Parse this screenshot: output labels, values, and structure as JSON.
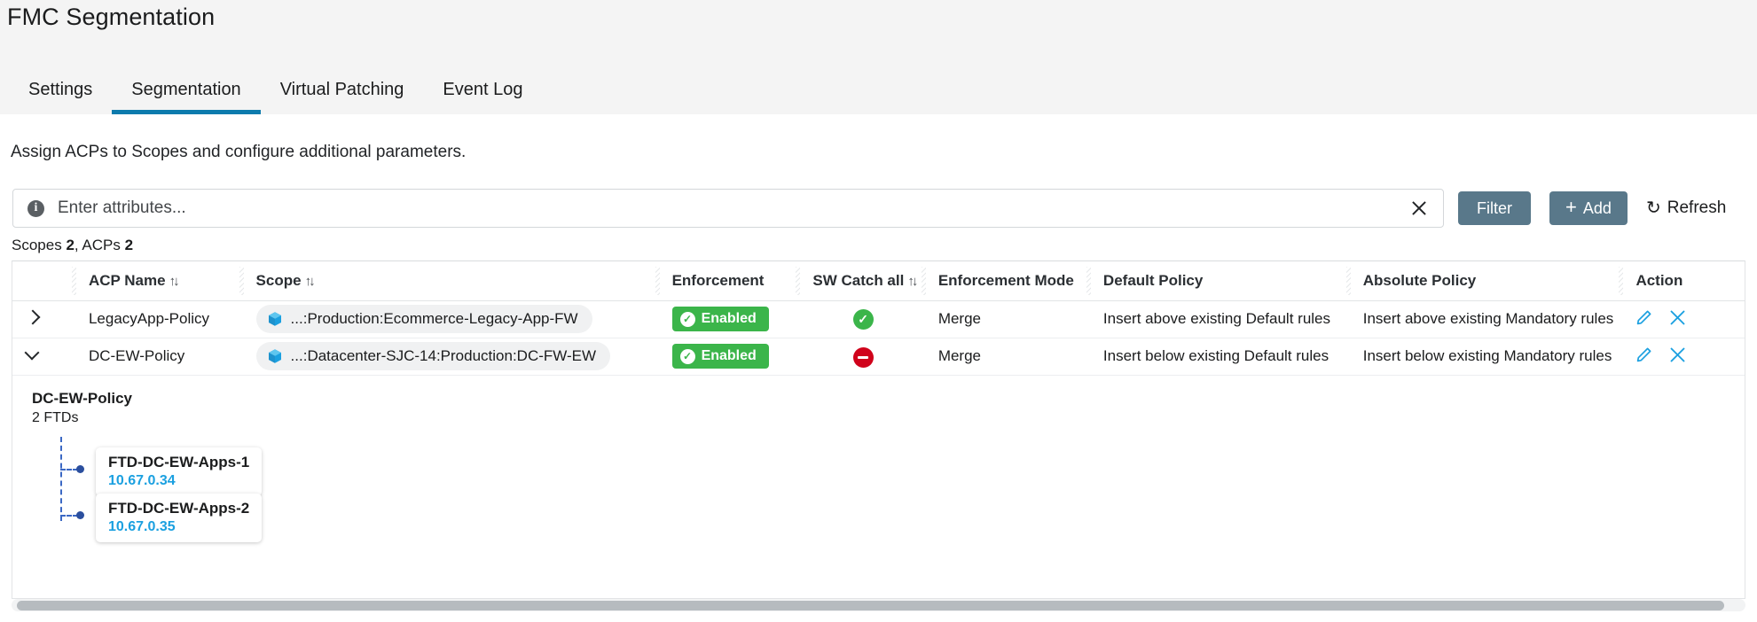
{
  "header": {
    "title": "FMC Segmentation"
  },
  "tabs": [
    {
      "label": "Settings",
      "active": false
    },
    {
      "label": "Segmentation",
      "active": true
    },
    {
      "label": "Virtual Patching",
      "active": false
    },
    {
      "label": "Event Log",
      "active": false
    }
  ],
  "main": {
    "subtitle": "Assign ACPs to Scopes and configure additional parameters.",
    "counts_prefix": "Scopes",
    "counts_scopes": "2",
    "counts_mid": ", ACPs",
    "counts_acps": "2"
  },
  "search": {
    "placeholder": "Enter attributes...",
    "value": "",
    "info_icon": "info-icon",
    "clear_icon": "close-icon"
  },
  "toolbar": {
    "filter_label": "Filter",
    "add_label": "Add",
    "add_plus": "+",
    "refresh_label": "Refresh",
    "refresh_icon": "↻"
  },
  "table": {
    "columns": [
      {
        "label": "",
        "sortable": false
      },
      {
        "label": "ACP Name",
        "sortable": true
      },
      {
        "label": "Scope",
        "sortable": true
      },
      {
        "label": "Enforcement",
        "sortable": false
      },
      {
        "label": "SW Catch all",
        "sortable": true
      },
      {
        "label": "Enforcement Mode",
        "sortable": false
      },
      {
        "label": "Default Policy",
        "sortable": false
      },
      {
        "label": "Absolute Policy",
        "sortable": false
      },
      {
        "label": "Action",
        "sortable": false
      }
    ],
    "sort_glyph": "↑↓",
    "rows": [
      {
        "expanded": false,
        "acp_name": "LegacyApp-Policy",
        "scope": "...:Production:Ecommerce-Legacy-App-FW",
        "enforcement": "Enabled",
        "sw_catch_all": "enabled",
        "enforcement_mode": "Merge",
        "default_policy": "Insert above existing Default rules",
        "absolute_policy": "Insert above existing Mandatory rules"
      },
      {
        "expanded": true,
        "acp_name": "DC-EW-Policy",
        "scope": "...:Datacenter-SJC-14:Production:DC-FW-EW",
        "enforcement": "Enabled",
        "sw_catch_all": "disabled",
        "enforcement_mode": "Merge",
        "default_policy": "Insert below existing Default rules",
        "absolute_policy": "Insert below existing Mandatory rules"
      }
    ]
  },
  "detail": {
    "title": "DC-EW-Policy",
    "subtitle": "2 FTDs",
    "nodes": [
      {
        "name": "FTD-DC-EW-Apps-1",
        "ip": "10.67.0.34"
      },
      {
        "name": "FTD-DC-EW-Apps-2",
        "ip": "10.67.0.35"
      }
    ]
  },
  "colors": {
    "accent": "#0d7bad",
    "button": "#59788a",
    "enabled_green": "#3bb54a",
    "disabled_red": "#d0021b",
    "link_blue": "#1ba0e0",
    "tree_blue": "#3b68c4"
  }
}
